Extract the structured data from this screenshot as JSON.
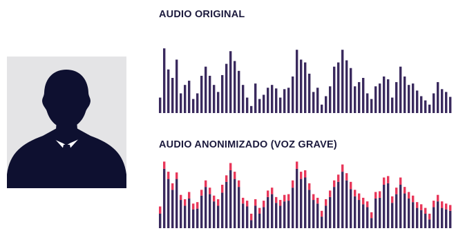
{
  "labels": {
    "original": "AUDIO ORIGINAL",
    "anonymized": "AUDIO ANONIMIZADO (VOZ GRAVE)"
  },
  "icons": {
    "avatar": "person-silhouette-icon"
  },
  "colors": {
    "bar": "#3a2a5e",
    "accent": "#e8375a",
    "avatar_bg": "#e4e4e6",
    "silhouette": "#0e1030",
    "shirt": "#ffffff"
  },
  "waveforms": {
    "original": {
      "levels": [
        0.22,
        0.92,
        0.62,
        0.5,
        0.76,
        0.28,
        0.4,
        0.46,
        0.2,
        0.28,
        0.53,
        0.66,
        0.53,
        0.4,
        0.3,
        0.54,
        0.7,
        0.88,
        0.74,
        0.6,
        0.4,
        0.22,
        0.1,
        0.42,
        0.2,
        0.26,
        0.36,
        0.4,
        0.35,
        0.22,
        0.34,
        0.36,
        0.52,
        0.9,
        0.76,
        0.72,
        0.56,
        0.3,
        0.36,
        0.12,
        0.24,
        0.38,
        0.66,
        0.72,
        0.9,
        0.75,
        0.64,
        0.38,
        0.44,
        0.5,
        0.28,
        0.2,
        0.38,
        0.42,
        0.52,
        0.48,
        0.22,
        0.44,
        0.66,
        0.52,
        0.4,
        0.42,
        0.32,
        0.24,
        0.18,
        0.12,
        0.28,
        0.44,
        0.34,
        0.3,
        0.23
      ]
    },
    "anonymized": {
      "levels": [
        0.3,
        0.92,
        0.78,
        0.62,
        0.77,
        0.46,
        0.4,
        0.5,
        0.34,
        0.36,
        0.53,
        0.66,
        0.56,
        0.45,
        0.4,
        0.6,
        0.73,
        0.9,
        0.78,
        0.66,
        0.42,
        0.38,
        0.2,
        0.4,
        0.28,
        0.38,
        0.52,
        0.56,
        0.43,
        0.39,
        0.46,
        0.47,
        0.66,
        0.92,
        0.78,
        0.8,
        0.62,
        0.47,
        0.42,
        0.24,
        0.4,
        0.52,
        0.66,
        0.74,
        0.88,
        0.76,
        0.64,
        0.53,
        0.48,
        0.42,
        0.37,
        0.22,
        0.5,
        0.51,
        0.7,
        0.72,
        0.44,
        0.56,
        0.7,
        0.57,
        0.5,
        0.45,
        0.36,
        0.33,
        0.28,
        0.2,
        0.38,
        0.46,
        0.37,
        0.34,
        0.32
      ],
      "caps": [
        0.1,
        0.1,
        0.1,
        0.09,
        0.09,
        0.07,
        0.09,
        0.09,
        0.08,
        0.09,
        0.08,
        0.09,
        0.09,
        0.08,
        0.09,
        0.11,
        0.09,
        0.1,
        0.1,
        0.09,
        0.08,
        0.08,
        0.09,
        0.09,
        0.08,
        0.09,
        0.09,
        0.09,
        0.08,
        0.08,
        0.09,
        0.09,
        0.1,
        0.1,
        0.1,
        0.1,
        0.09,
        0.08,
        0.08,
        0.08,
        0.09,
        0.09,
        0.09,
        0.1,
        0.1,
        0.1,
        0.1,
        0.09,
        0.09,
        0.09,
        0.08,
        0.08,
        0.09,
        0.09,
        0.1,
        0.1,
        0.09,
        0.09,
        0.1,
        0.09,
        0.09,
        0.09,
        0.08,
        0.08,
        0.08,
        0.08,
        0.09,
        0.09,
        0.09,
        0.08,
        0.08
      ]
    }
  }
}
